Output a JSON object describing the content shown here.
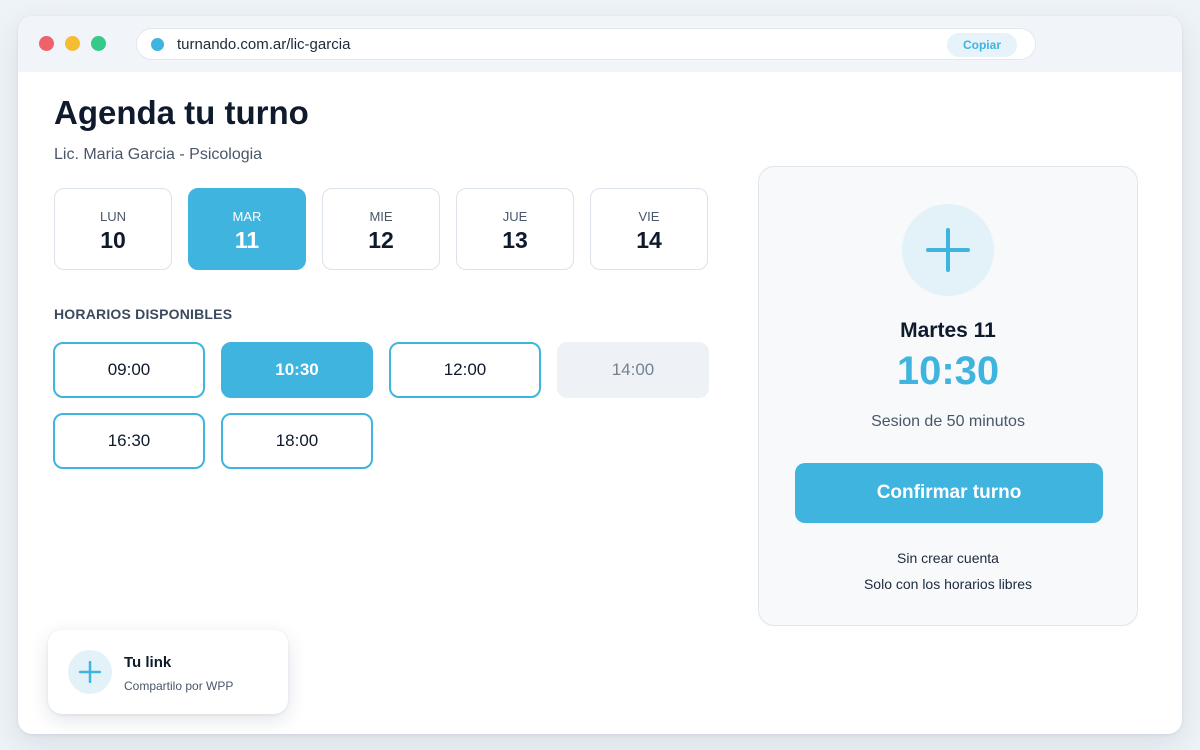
{
  "browser": {
    "url": "turnando.com.ar/lic-garcia",
    "copy_label": "Copiar"
  },
  "page": {
    "title": "Agenda tu turno",
    "subtitle": "Lic. Maria Garcia - Psicologia"
  },
  "days": [
    {
      "name": "LUN",
      "num": "10",
      "selected": false
    },
    {
      "name": "MAR",
      "num": "11",
      "selected": true
    },
    {
      "name": "MIE",
      "num": "12",
      "selected": false
    },
    {
      "name": "JUE",
      "num": "13",
      "selected": false
    },
    {
      "name": "VIE",
      "num": "14",
      "selected": false
    }
  ],
  "slots_label": "HORARIOS DISPONIBLES",
  "slots": [
    {
      "time": "09:00",
      "state": "available"
    },
    {
      "time": "10:30",
      "state": "selected"
    },
    {
      "time": "12:00",
      "state": "available"
    },
    {
      "time": "14:00",
      "state": "unavailable"
    },
    {
      "time": "16:30",
      "state": "available"
    },
    {
      "time": "18:00",
      "state": "available"
    }
  ],
  "summary": {
    "day": "Martes 11",
    "time": "10:30",
    "duration": "Sesion de 50 minutos",
    "confirm_label": "Confirmar turno",
    "note1": "Sin crear cuenta",
    "note2": "Solo con los horarios libres"
  },
  "toast": {
    "title": "Tu link",
    "subtitle": "Compartilo por WPP"
  },
  "colors": {
    "accent": "#3fb4df",
    "text": "#0f1b2d",
    "muted": "#4a5668"
  },
  "icons": {
    "summary_icon": "plus-icon",
    "toast_icon": "plus-icon",
    "url_status": "site-dot-icon"
  }
}
